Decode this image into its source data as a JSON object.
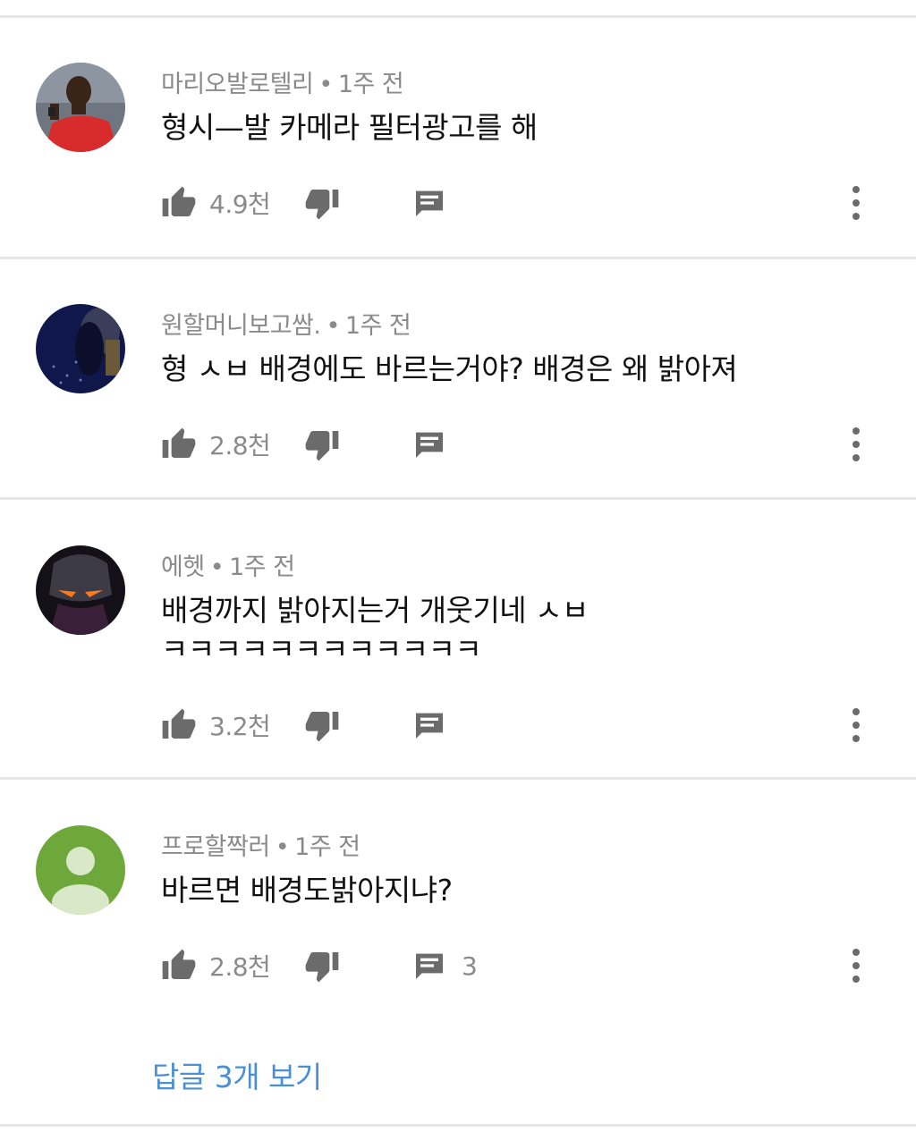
{
  "comments": [
    {
      "author": "마리오발로텔리",
      "time": "1주 전",
      "text": "형시—발 카메라 필터광고를 해",
      "likes": "4.9천",
      "replies": ""
    },
    {
      "author": "원할머니보고쌈.",
      "time": "1주 전",
      "text": "형 ㅅㅂ 배경에도 바르는거야? 배경은 왜 밝아져",
      "likes": "2.8천",
      "replies": ""
    },
    {
      "author": "에헷",
      "time": "1주 전",
      "text_line1": "배경까지 밝아지는거 개웃기네 ㅅㅂ",
      "text_line2": "ㅋㅋㅋㅋㅋㅋㅋㅋㅋㅋㅋㅋ",
      "likes": "3.2천",
      "replies": ""
    },
    {
      "author": "프로할짝러",
      "time": "1주 전",
      "text": "바르면 배경도밝아지냐?",
      "likes": "2.8천",
      "replies": "3"
    }
  ],
  "separator": "•",
  "view_replies": "답글 3개 보기",
  "icons": {
    "like": "thumbs-up-icon",
    "dislike": "thumbs-down-icon",
    "reply": "comment-icon",
    "more": "more-vert-icon"
  },
  "colors": {
    "link": "#4a8fd6",
    "meta": "#8a8a8a",
    "divider": "#e6e6e6"
  }
}
